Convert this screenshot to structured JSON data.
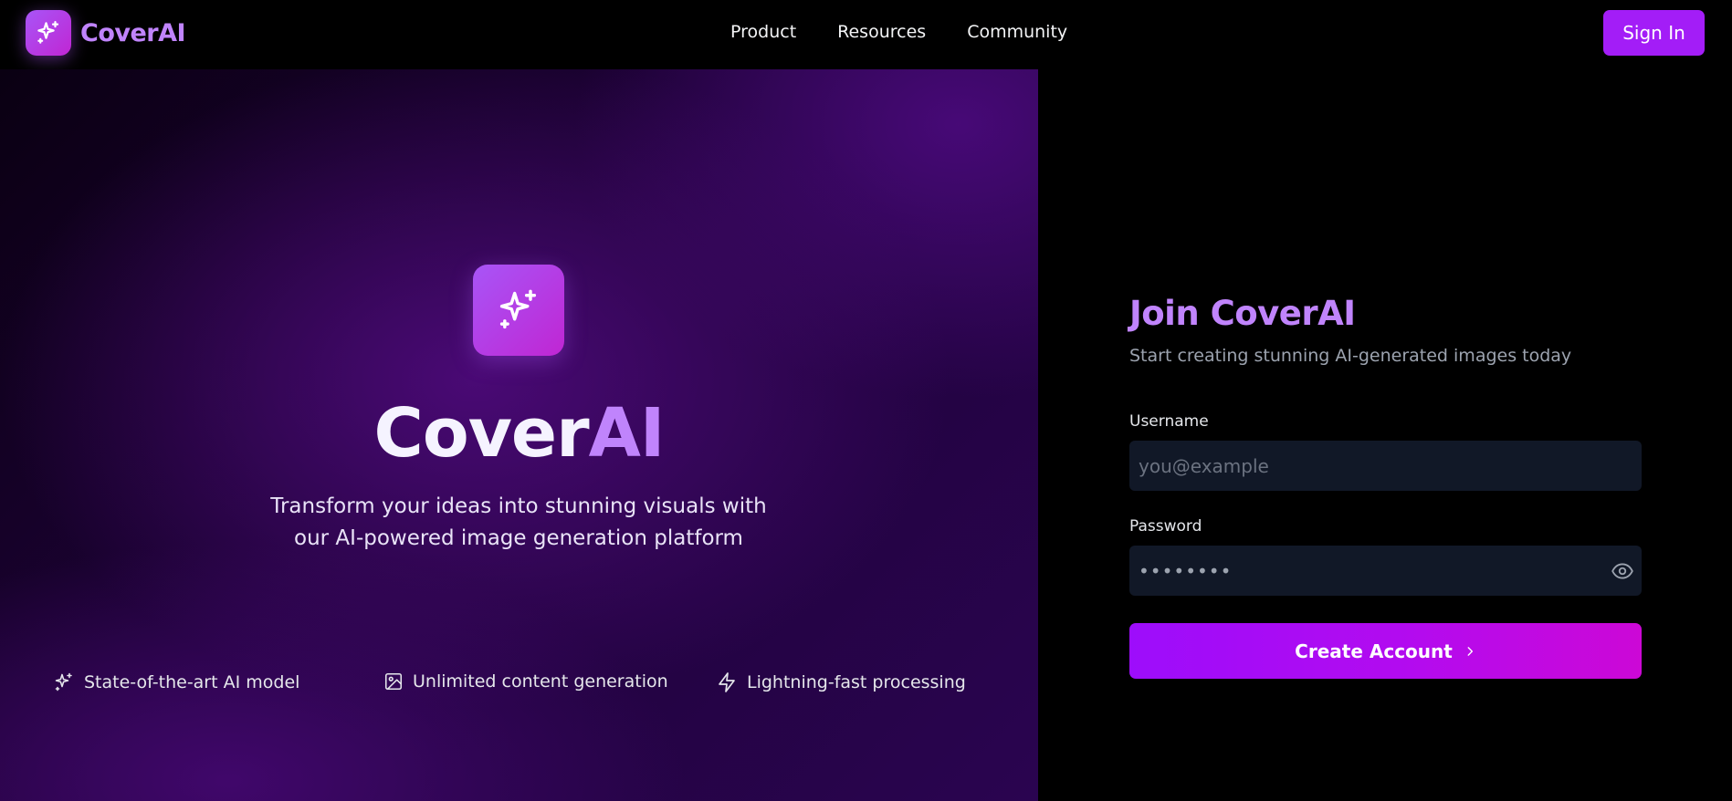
{
  "header": {
    "logo_text": "CoverAI",
    "nav": [
      "Product",
      "Resources",
      "Community"
    ],
    "signin_label": "Sign In"
  },
  "hero": {
    "title_part1": "Cover",
    "title_part2": "AI",
    "subtitle_line1": "Transform your ideas into stunning visuals with",
    "subtitle_line2": "our AI-powered image generation platform",
    "features": [
      {
        "icon": "sparkles-icon",
        "label": "State-of-the-art AI model"
      },
      {
        "icon": "image-icon",
        "label": "Unlimited content generation"
      },
      {
        "icon": "lightning-icon",
        "label": "Lightning-fast processing"
      }
    ]
  },
  "form": {
    "title": "Join CoverAI",
    "subtitle": "Start creating stunning AI-generated images today",
    "username_label": "Username",
    "username_placeholder": "you@example",
    "password_label": "Password",
    "password_value": "••••••••",
    "submit_label": "Create Account"
  },
  "colors": {
    "accent": "#c084fc",
    "button": "#a31df7",
    "gradient_start": "#9d0dfb",
    "gradient_end": "#cc08d6"
  }
}
